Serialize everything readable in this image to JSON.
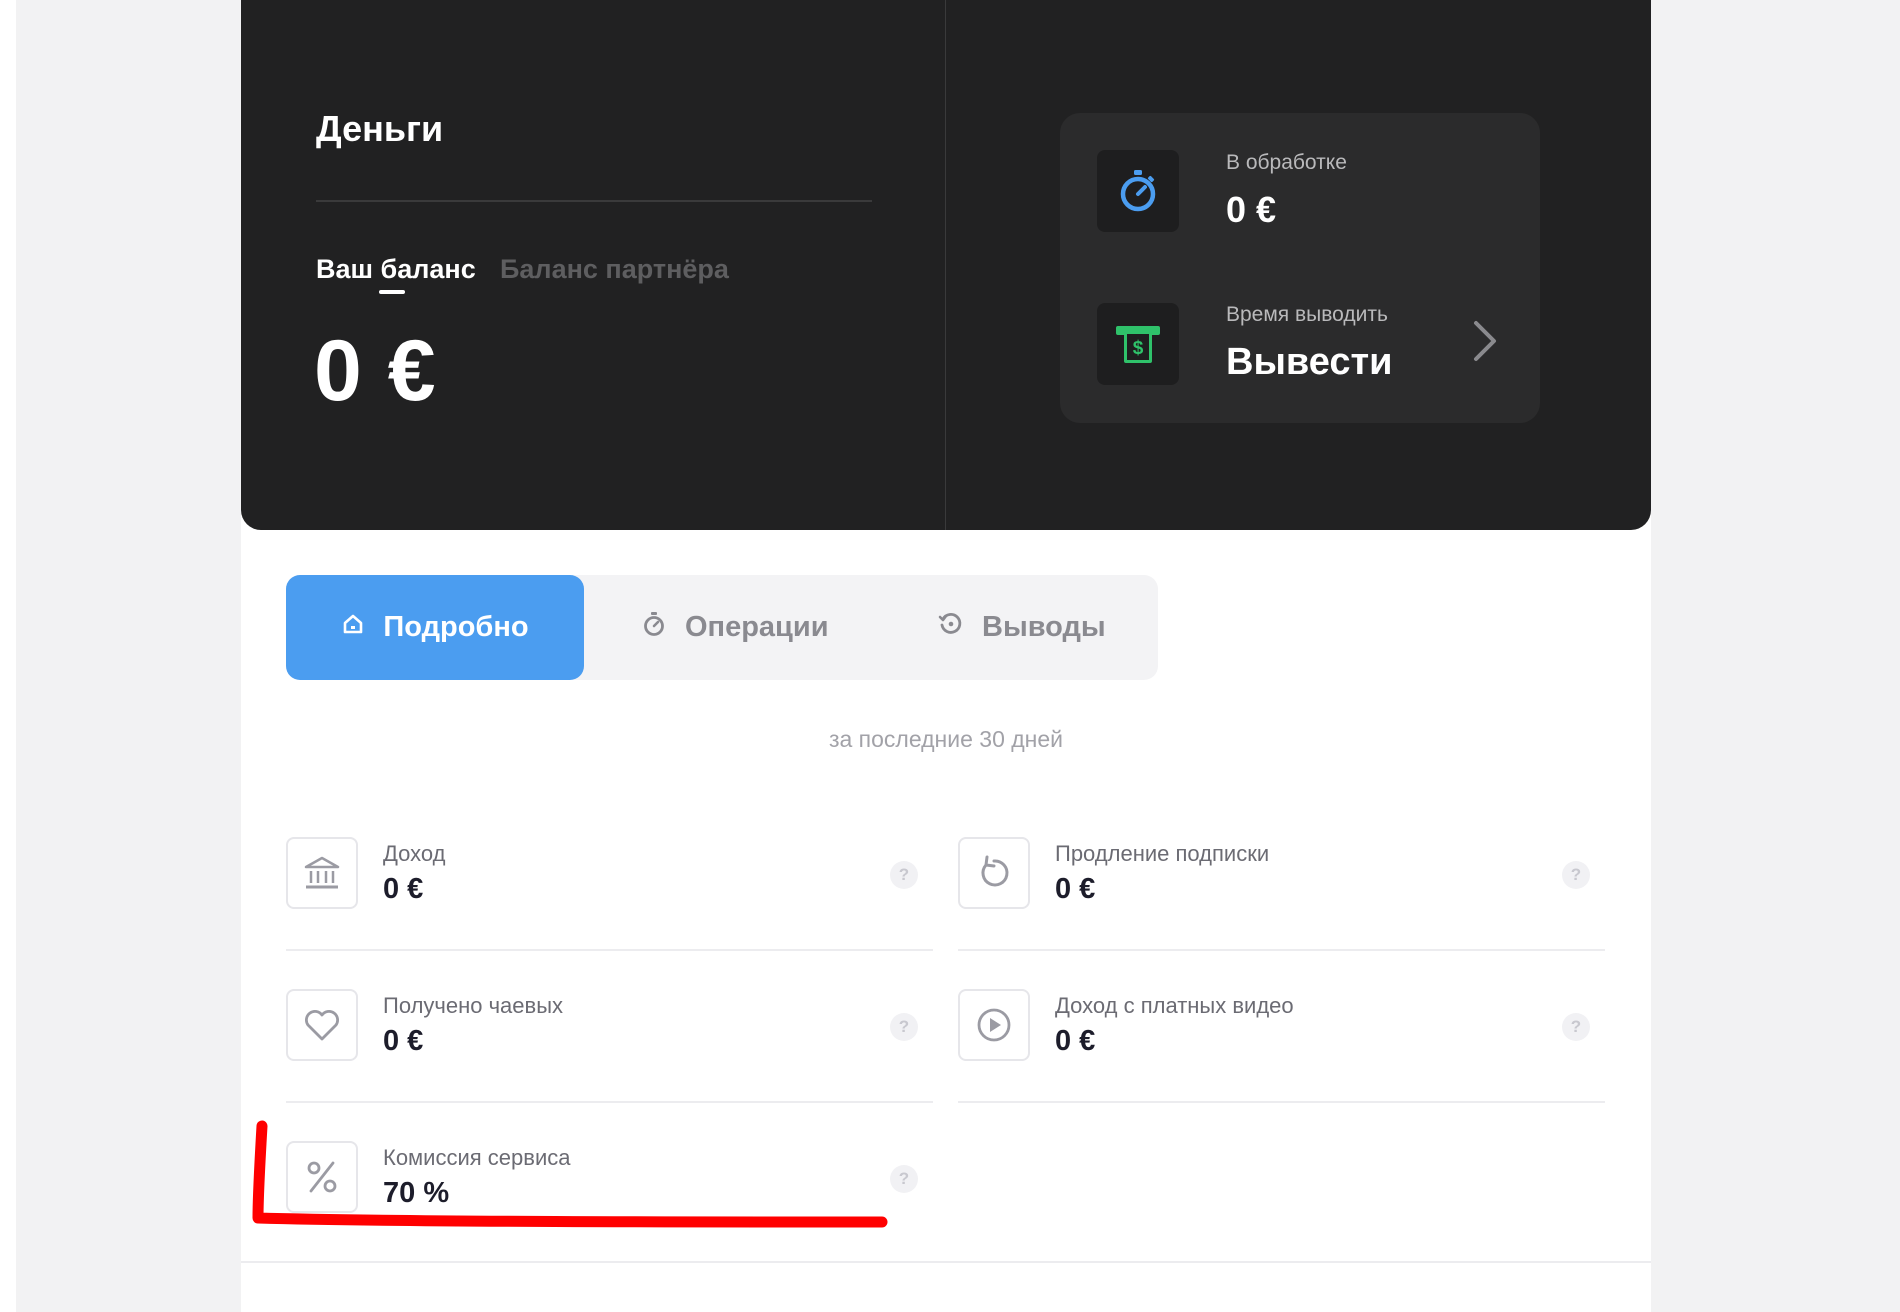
{
  "hero": {
    "title": "Деньги",
    "tab_own": "Ваш баланс",
    "tab_partner": "Баланс партнёра",
    "balance": "0 €"
  },
  "side_card": {
    "processing_label": "В обработке",
    "processing_value": "0 €",
    "withdraw_label": "Время выводить",
    "withdraw_action": "Вывести"
  },
  "tabs": [
    {
      "label": "Подробно",
      "icon": "home-icon"
    },
    {
      "label": "Операции",
      "icon": "stopwatch-icon"
    },
    {
      "label": "Выводы",
      "icon": "history-icon"
    }
  ],
  "period": "за последние 30 дней",
  "stats": [
    {
      "label": "Доход",
      "value": "0 €",
      "icon": "bank-icon"
    },
    {
      "label": "Продление подписки",
      "value": "0 €",
      "icon": "refresh-icon"
    },
    {
      "label": "Получено чаевых",
      "value": "0 €",
      "icon": "heart-icon"
    },
    {
      "label": "Доход с платных видео",
      "value": "0 €",
      "icon": "play-icon"
    },
    {
      "label": "Комиссия сервиса",
      "value": "70 %",
      "icon": "percent-icon"
    }
  ],
  "help_glyph": "?",
  "colors": {
    "hero_bg": "#212122",
    "accent_blue": "#4b9df0",
    "money_green": "#2fc26a",
    "annotation_red": "#ff0000"
  }
}
